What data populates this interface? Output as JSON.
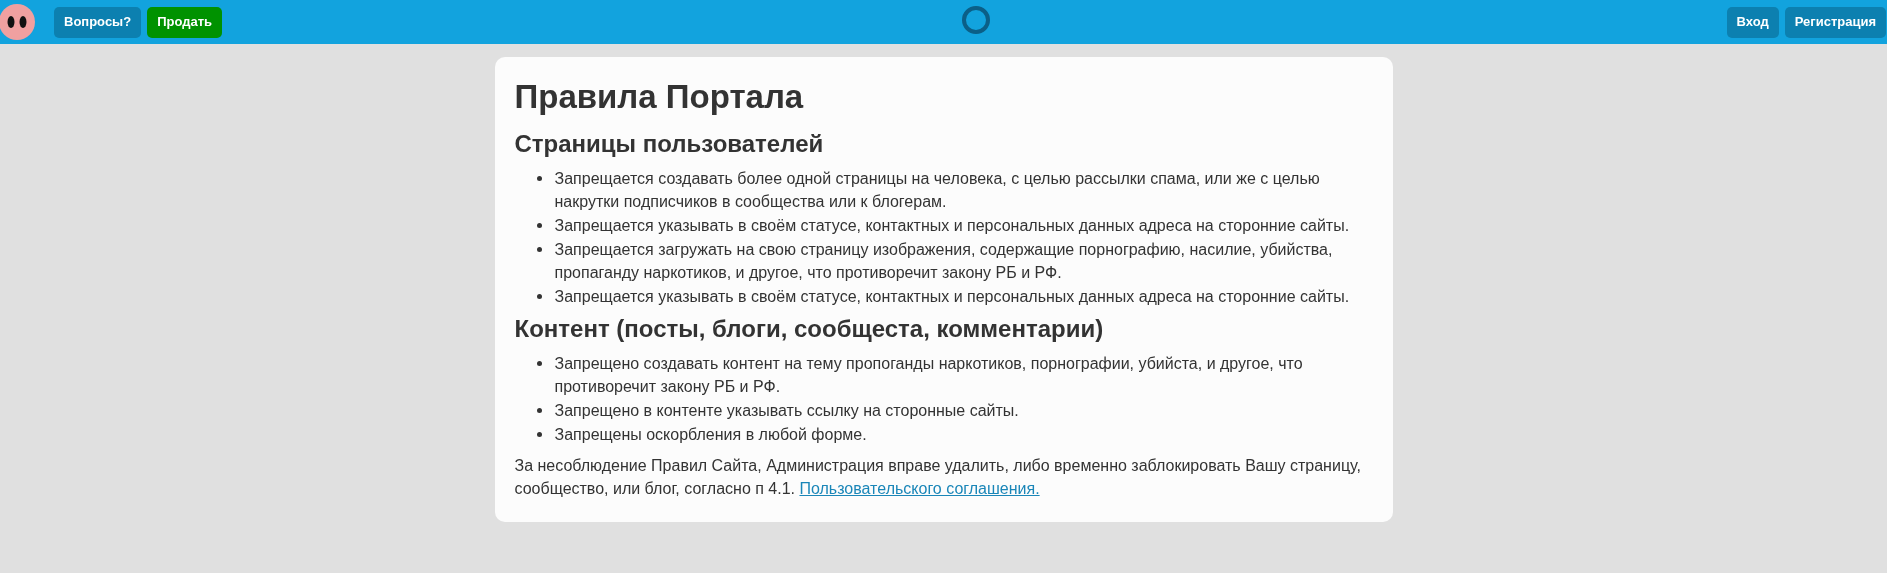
{
  "header": {
    "left_buttons": [
      {
        "label": "Вопросы?",
        "kind": "info"
      },
      {
        "label": "Продать",
        "kind": "accent"
      }
    ],
    "right_buttons": [
      {
        "label": "Вход",
        "kind": "info"
      },
      {
        "label": "Регистрация",
        "kind": "info"
      }
    ]
  },
  "page": {
    "title": "Правила Портала",
    "sections": [
      {
        "heading": "Страницы пользователей",
        "items": [
          "Запрещается создавать более одной страницы на человека, с целью рассылки спама, или же с целью накрутки подписчиков в сообщества или к блогерам.",
          "Запрещается указывать в своём статусе, контактных и персональных данных адреса на сторонние сайты.",
          "Запрещается загружать на свою страницу изображения, содержащие порнографию, насилие, убийства, пропаганду наркотиков, и другое, что противоречит закону РБ и РФ.",
          "Запрещается указывать в своём статусе, контактных и персональных данных адреса на сторонние сайты."
        ]
      },
      {
        "heading": "Контент (посты, блоги, сообщеста, комментарии)",
        "items": [
          "Запрещено создавать контент на тему пропоганды наркотиков, порнографии, убийста, и другое, что противоречит закону РБ и РФ.",
          "Запрещено в контенте указывать ссылку на сторонные сайты.",
          "Запрещены оскорбления в любой форме."
        ]
      }
    ],
    "footer_text": "За несоблюдение Правил Сайта, Администрация вправе удалить, либо временно заблокировать Вашу страницу, сообщество, или блог, согласно п 4.1.",
    "footer_link": "Пользовательского соглашения."
  }
}
